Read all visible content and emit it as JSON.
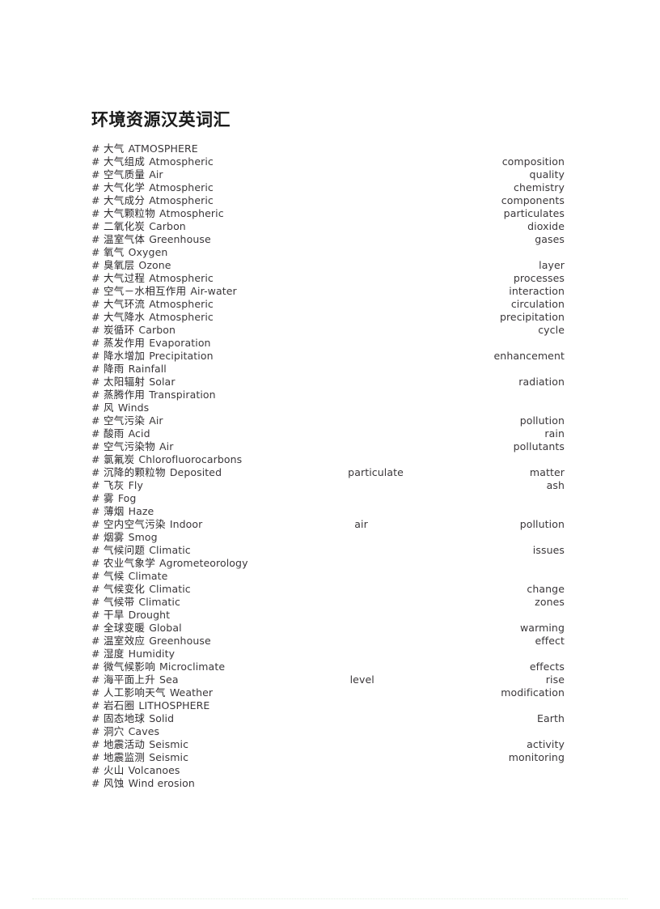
{
  "document": {
    "title": "环境资源汉英词汇",
    "bullet": "#"
  },
  "entries": [
    {
      "zh": "大气",
      "en": [
        "ATMOSPHERE"
      ]
    },
    {
      "zh": "大气组成",
      "en": [
        "Atmospheric",
        "composition"
      ]
    },
    {
      "zh": "空气质量",
      "en": [
        "Air",
        "quality"
      ]
    },
    {
      "zh": "大气化学",
      "en": [
        "Atmospheric",
        "chemistry"
      ]
    },
    {
      "zh": "大气成分",
      "en": [
        "Atmospheric",
        "components"
      ]
    },
    {
      "zh": "大气颗粒物",
      "en": [
        "Atmospheric",
        "particulates"
      ]
    },
    {
      "zh": "二氧化炭",
      "en": [
        "Carbon",
        "dioxide"
      ]
    },
    {
      "zh": "温室气体",
      "en": [
        "Greenhouse",
        "gases"
      ]
    },
    {
      "zh": "氧气",
      "en": [
        "Oxygen"
      ]
    },
    {
      "zh": "臭氧层",
      "en": [
        "Ozone",
        "layer"
      ]
    },
    {
      "zh": "大气过程",
      "en": [
        "Atmospheric",
        "processes"
      ]
    },
    {
      "zh": "空气－水相互作用",
      "en": [
        "Air-water",
        "interaction"
      ]
    },
    {
      "zh": "大气环流",
      "en": [
        "Atmospheric",
        "circulation"
      ]
    },
    {
      "zh": "大气降水",
      "en": [
        "Atmospheric",
        "precipitation"
      ]
    },
    {
      "zh": "炭循环",
      "en": [
        "Carbon",
        "cycle"
      ]
    },
    {
      "zh": "蒸发作用",
      "en": [
        "Evaporation"
      ]
    },
    {
      "zh": "降水增加",
      "en": [
        "Precipitation",
        "enhancement"
      ]
    },
    {
      "zh": "降雨",
      "en": [
        "Rainfall"
      ]
    },
    {
      "zh": "太阳辐射",
      "en": [
        "Solar",
        "radiation"
      ]
    },
    {
      "zh": "蒸腾作用",
      "en": [
        "Transpiration"
      ]
    },
    {
      "zh": "风",
      "en": [
        "Winds"
      ]
    },
    {
      "zh": "空气污染",
      "en": [
        "Air",
        "pollution"
      ]
    },
    {
      "zh": "酸雨",
      "en": [
        "Acid",
        "rain"
      ]
    },
    {
      "zh": "空气污染物",
      "en": [
        "Air",
        "pollutants"
      ]
    },
    {
      "zh": "氯氟炭",
      "en": [
        "Chlorofluorocarbons"
      ]
    },
    {
      "zh": "沉降的颗粒物",
      "en": [
        "Deposited",
        "particulate",
        "matter"
      ]
    },
    {
      "zh": "飞灰",
      "en": [
        "Fly",
        "ash"
      ]
    },
    {
      "zh": "雾",
      "en": [
        "Fog"
      ]
    },
    {
      "zh": "薄烟",
      "en": [
        "Haze"
      ]
    },
    {
      "zh": "空内空气污染",
      "en": [
        "Indoor",
        "air",
        "pollution"
      ]
    },
    {
      "zh": "烟雾",
      "en": [
        "Smog"
      ]
    },
    {
      "zh": "气候问题",
      "en": [
        "Climatic",
        "issues"
      ]
    },
    {
      "zh": "农业气象学",
      "en": [
        "Agrometeorology"
      ]
    },
    {
      "zh": "气候",
      "en": [
        "Climate"
      ]
    },
    {
      "zh": "气候变化",
      "en": [
        "Climatic",
        "change"
      ]
    },
    {
      "zh": "气候带",
      "en": [
        "Climatic",
        "zones"
      ]
    },
    {
      "zh": "干旱",
      "en": [
        "Drought"
      ]
    },
    {
      "zh": "全球变暖",
      "en": [
        "Global",
        "warming"
      ]
    },
    {
      "zh": "温室效应",
      "en": [
        "Greenhouse",
        "effect"
      ]
    },
    {
      "zh": "湿度",
      "en": [
        "Humidity"
      ]
    },
    {
      "zh": "微气候影响",
      "en": [
        "Microclimate",
        "effects"
      ]
    },
    {
      "zh": "海平面上升",
      "en": [
        "Sea",
        "level",
        "rise"
      ]
    },
    {
      "zh": "人工影响天气",
      "en": [
        "Weather",
        "modification"
      ]
    },
    {
      "zh": "岩石圈",
      "en": [
        "LITHOSPHERE"
      ]
    },
    {
      "zh": "固态地球",
      "en": [
        "Solid",
        "Earth"
      ]
    },
    {
      "zh": "洞穴",
      "en": [
        "Caves"
      ]
    },
    {
      "zh": "地震活动",
      "en": [
        "Seismic",
        "activity"
      ]
    },
    {
      "zh": "地震监测",
      "en": [
        "Seismic",
        "monitoring"
      ]
    },
    {
      "zh": "火山",
      "en": [
        "Volcanoes"
      ]
    },
    {
      "zh": "风蚀",
      "en": [
        "Wind erosion"
      ]
    }
  ],
  "decor": {
    "bottom_rule_color": "#cfe8cf"
  }
}
